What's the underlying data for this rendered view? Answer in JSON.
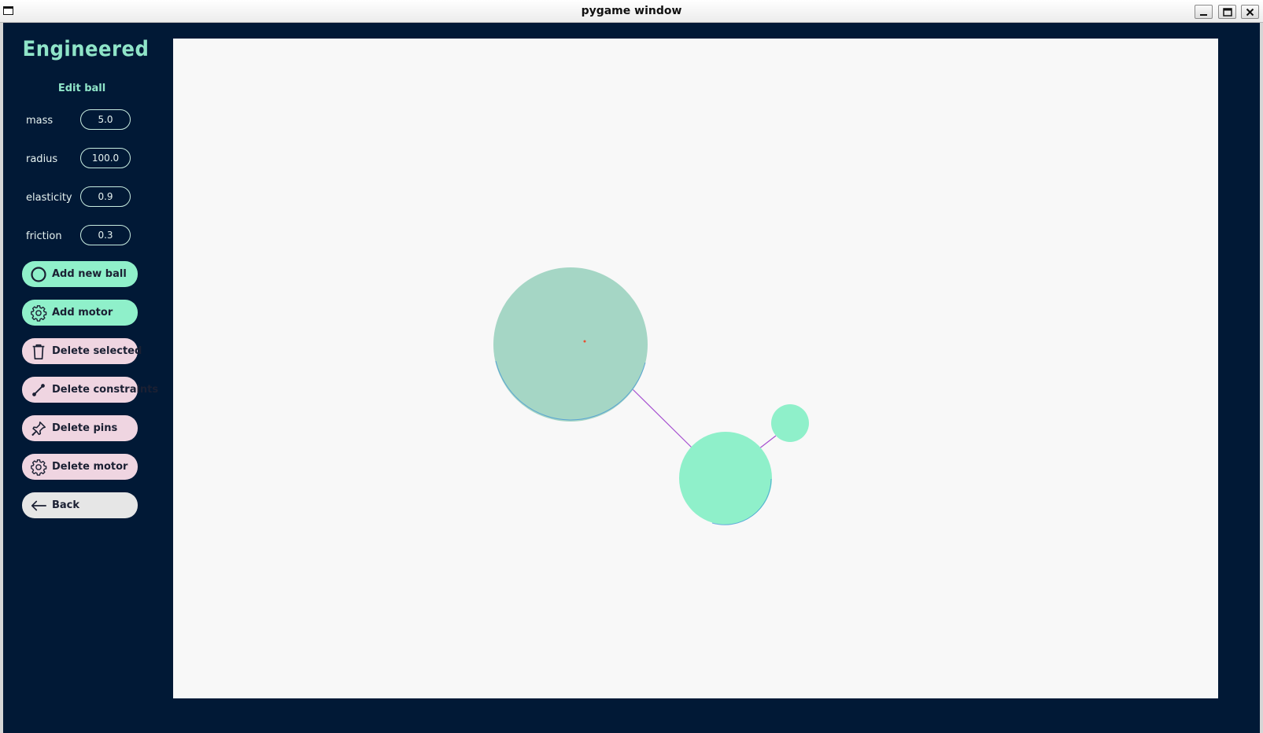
{
  "window": {
    "title": "pygame window",
    "controls": {
      "minimize": "minimize",
      "maximize": "maximize",
      "close": "close"
    }
  },
  "app": {
    "name": "Engineered"
  },
  "panel": {
    "title": "Edit ball",
    "params": [
      {
        "label": "mass",
        "value": "5.0"
      },
      {
        "label": "radius",
        "value": "100.0"
      },
      {
        "label": "elasticity",
        "value": "0.9"
      },
      {
        "label": "friction",
        "value": "0.3"
      }
    ],
    "buttons": [
      {
        "label": "Add new ball",
        "icon": "circle-icon",
        "style": "primary"
      },
      {
        "label": "Add motor",
        "icon": "gear-icon",
        "style": "primary"
      },
      {
        "label": "Delete selected",
        "icon": "trash-icon",
        "style": "danger"
      },
      {
        "label": "Delete constraints",
        "icon": "link-icon",
        "style": "danger"
      },
      {
        "label": "Delete pins",
        "icon": "pin-icon",
        "style": "danger"
      },
      {
        "label": "Delete motor",
        "icon": "gear-icon",
        "style": "danger"
      },
      {
        "label": "Back",
        "icon": "arrow-left-icon",
        "style": "neutral"
      }
    ]
  },
  "colors": {
    "sidebar_bg": "#011936",
    "accent": "#8ff0ca",
    "danger_button": "#efd5e1",
    "neutral_button": "#e6e6e6",
    "selected_ball": "#a5d6c5",
    "ball": "#8ff0ca",
    "constraint_line": "#a64fd0",
    "canvas_bg": "#f8f8f8"
  }
}
